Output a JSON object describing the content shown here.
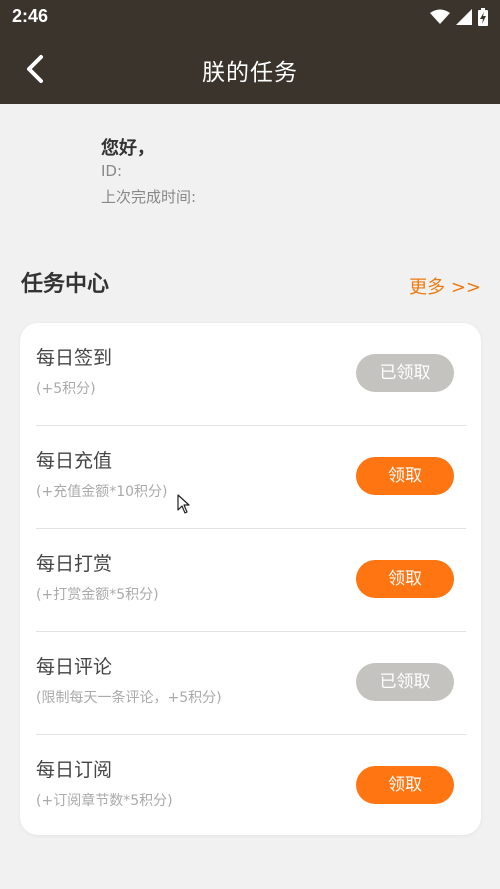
{
  "status_bar": {
    "time": "2:46"
  },
  "header": {
    "title": "朕的任务"
  },
  "profile": {
    "greeting": "您好，",
    "id_label": "ID:",
    "last_done_label": "上次完成时间:"
  },
  "tasks_section": {
    "title": "任务中心",
    "more_label": "更多 >>"
  },
  "tasks": [
    {
      "name": "每日签到",
      "desc": "(+5积分)",
      "button": "已领取",
      "state": "claimed"
    },
    {
      "name": "每日充值",
      "desc": "(+充值金额*10积分)",
      "button": "领取",
      "state": "available"
    },
    {
      "name": "每日打赏",
      "desc": "(+打赏金额*5积分)",
      "button": "领取",
      "state": "available"
    },
    {
      "name": "每日评论",
      "desc": "(限制每天一条评论，+5积分)",
      "button": "已领取",
      "state": "claimed"
    },
    {
      "name": "每日订阅",
      "desc": "(+订阅章节数*5积分)",
      "button": "领取",
      "state": "available"
    }
  ],
  "colors": {
    "header_bg": "#3a342d",
    "accent": "#ff7512",
    "claimed_btn": "#c4c3c0",
    "more_link": "#f07a10"
  },
  "icons": [
    "back-arrow-icon",
    "wifi-icon",
    "cell-signal-icon",
    "battery-charging-icon",
    "mouse-pointer-icon"
  ]
}
